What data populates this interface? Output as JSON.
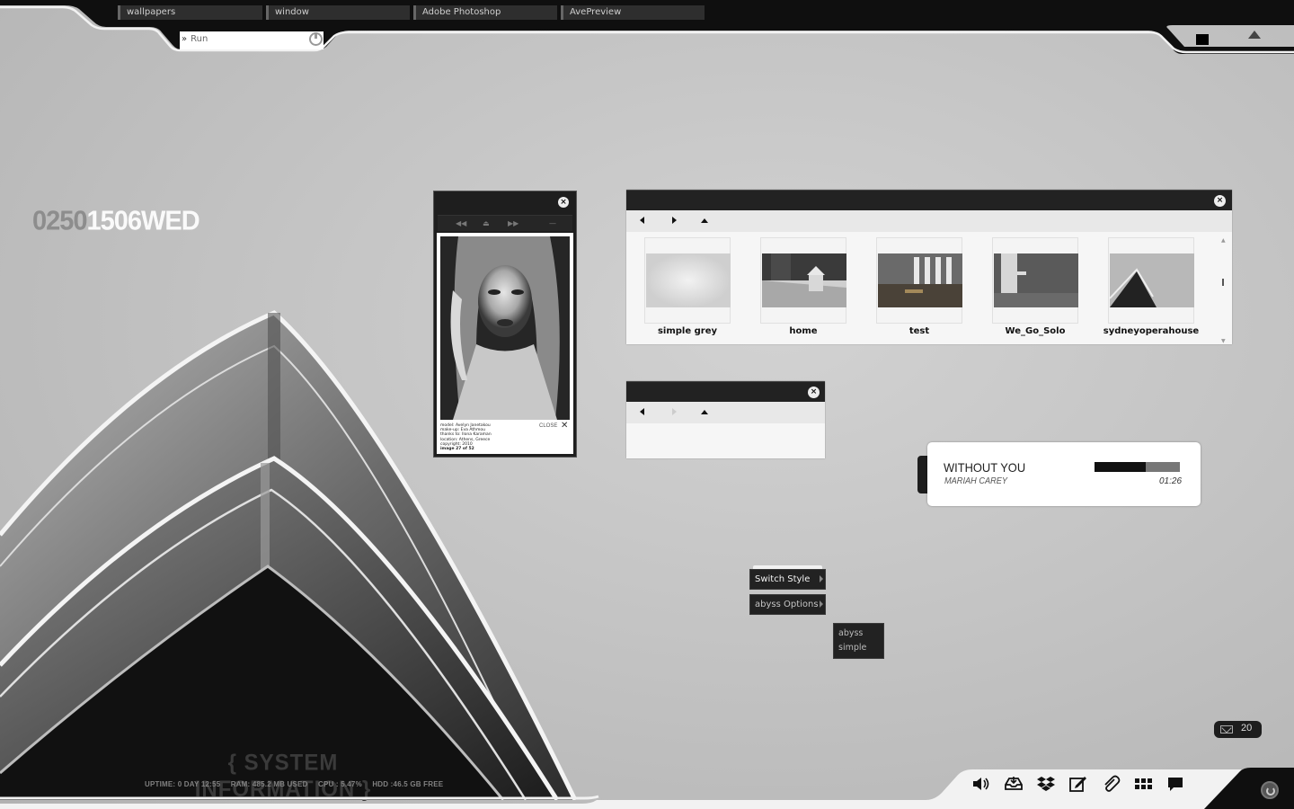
{
  "taskbar": {
    "tasks": [
      "wallpapers",
      "window",
      "Adobe Photoshop",
      "AvePreview"
    ],
    "run_label": "Run"
  },
  "clock": {
    "dim": "0250",
    "bright": "1506WED"
  },
  "system_info": {
    "title": "{ SYSTEM INFORMATION }",
    "uptime": "UPTIME: 0 DAY 12:55",
    "ram": "RAM:  485.2 MB USED",
    "cpu": "CPU :  5.47%",
    "hdd": "HDD :46.5 GB FREE"
  },
  "photo_viewer": {
    "caption_lines": [
      "model: Avelyn Janetakou",
      "make-up: Eva Athmou",
      "thanks to: Ilona Karaman",
      "location: Athens, Greece",
      "copyright: 2010",
      "image 27 of 52"
    ],
    "close_label": "CLOSE"
  },
  "explorer": {
    "items": [
      {
        "label": "simple grey",
        "thumb": "simple-grey"
      },
      {
        "label": "home",
        "thumb": "home"
      },
      {
        "label": "test",
        "thumb": "test"
      },
      {
        "label": "We_Go_Solo",
        "thumb": "we-go-solo"
      },
      {
        "label": "sydneyoperahouse",
        "thumb": "sydney"
      }
    ]
  },
  "music": {
    "title": "WITHOUT YOU",
    "artist": "MARIAH CAREY",
    "time": "01:26",
    "progress": 0.6
  },
  "context_menu": {
    "items": [
      "Switch Style",
      "abyss Options"
    ],
    "submenu": [
      "abyss",
      "simple"
    ]
  },
  "mail": {
    "count": "20"
  },
  "dock": {
    "icons": [
      "volume-icon",
      "inbox-icon",
      "dropbox-icon",
      "edit-icon",
      "paperclip-icon",
      "grid-icon",
      "chat-icon"
    ]
  },
  "colors": {
    "bar": "#0f0f0f",
    "accent": "#ffffff",
    "panel": "#222222"
  }
}
